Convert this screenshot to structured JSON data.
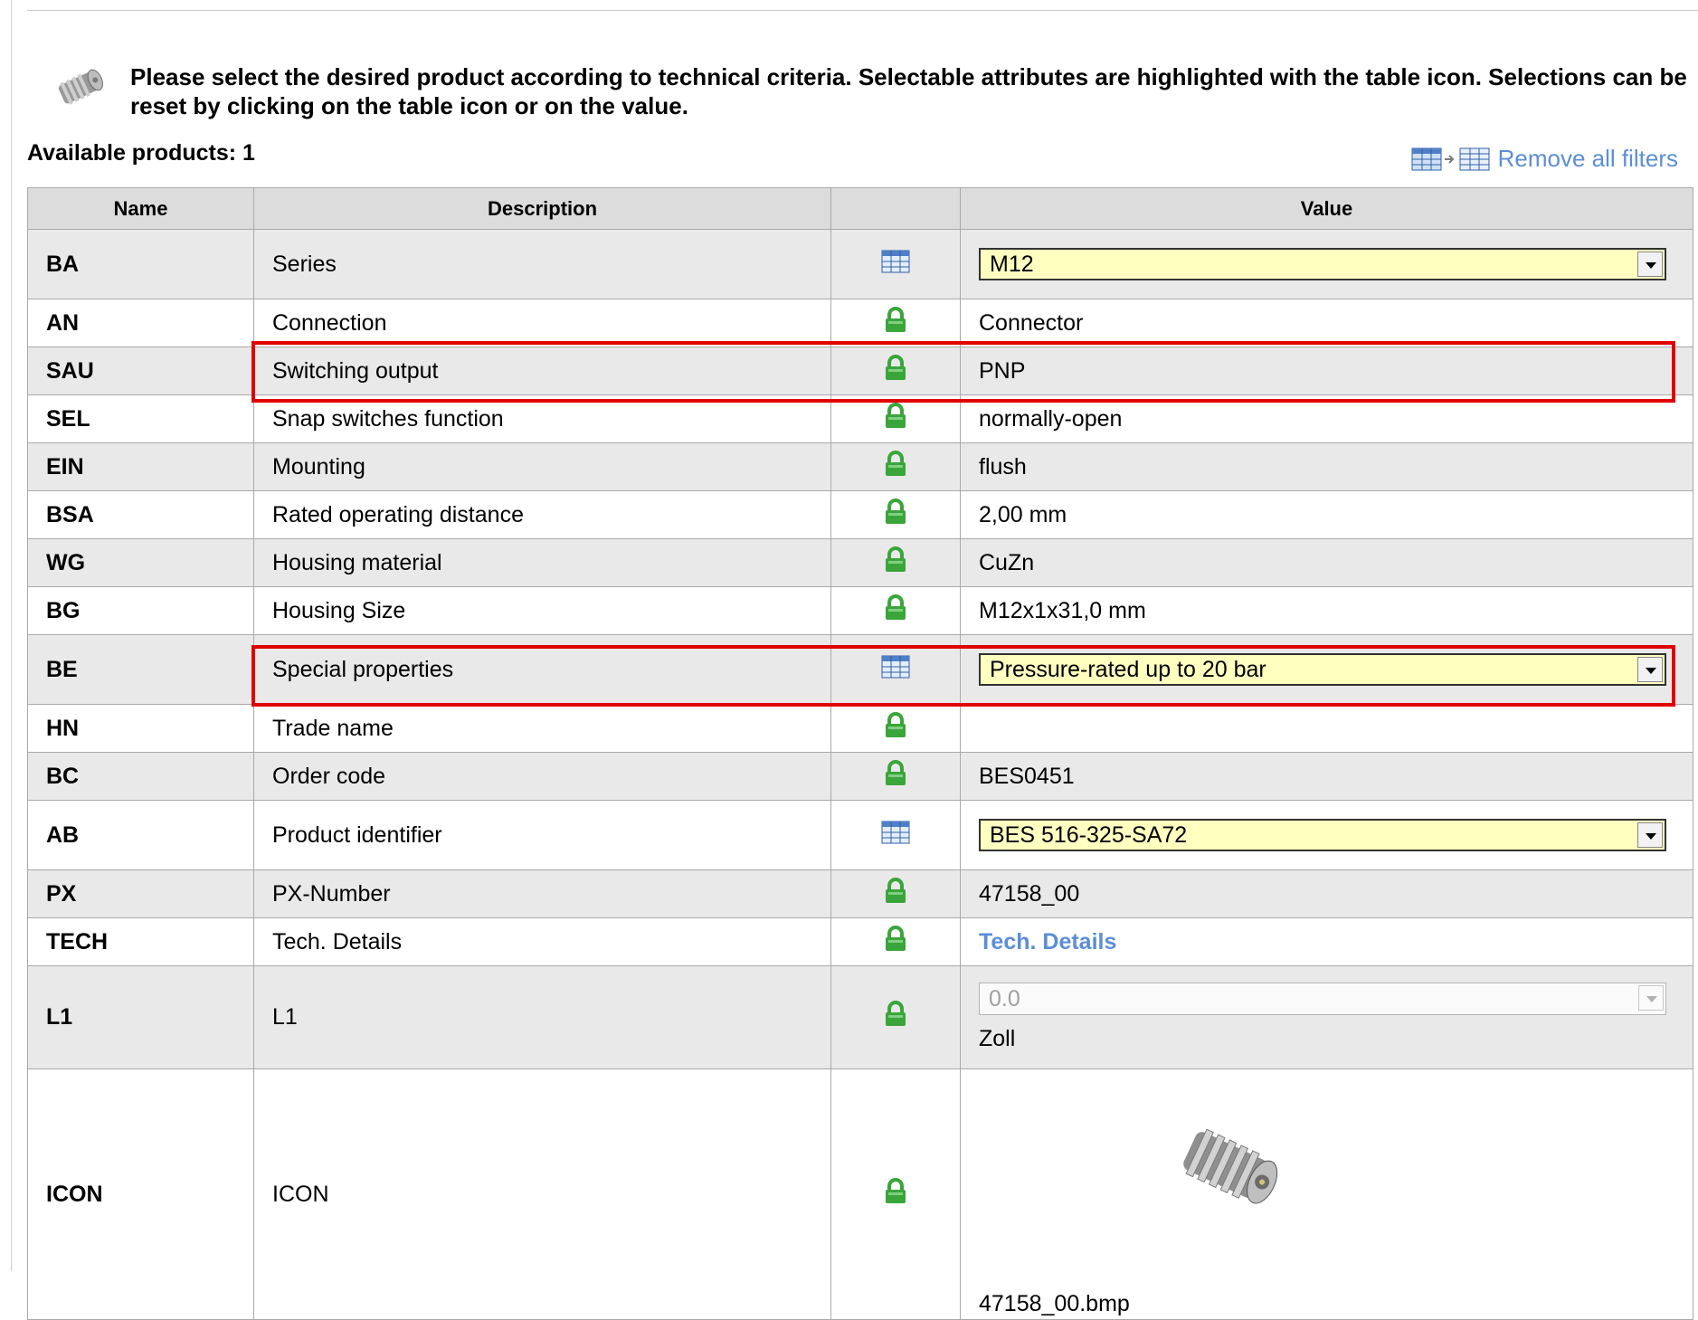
{
  "intro": {
    "text": "Please select the desired product according to technical criteria. Selectable attributes are highlighted with the table icon. Selections can be reset by clicking on the table icon or on the value."
  },
  "available_label": "Available products: 1",
  "remove_all_filters": "Remove all filters",
  "table": {
    "headers": {
      "name": "Name",
      "description": "Description",
      "icon": "",
      "value": "Value"
    },
    "rows": [
      {
        "name": "BA",
        "description": "Series",
        "icon": "table-icon",
        "value": "M12"
      },
      {
        "name": "AN",
        "description": "Connection",
        "icon": "lock-icon",
        "value": "Connector"
      },
      {
        "name": "SAU",
        "description": "Switching output",
        "icon": "lock-icon",
        "value": "PNP"
      },
      {
        "name": "SEL",
        "description": "Snap switches function",
        "icon": "lock-icon",
        "value": "normally-open"
      },
      {
        "name": "EIN",
        "description": "Mounting",
        "icon": "lock-icon",
        "value": "flush"
      },
      {
        "name": "BSA",
        "description": "Rated operating distance",
        "icon": "lock-icon",
        "value": "2,00 mm"
      },
      {
        "name": "WG",
        "description": "Housing material",
        "icon": "lock-icon",
        "value": "CuZn"
      },
      {
        "name": "BG",
        "description": "Housing Size",
        "icon": "lock-icon",
        "value": "M12x1x31,0 mm"
      },
      {
        "name": "BE",
        "description": "Special properties",
        "icon": "table-icon",
        "value": "Pressure-rated up to 20 bar"
      },
      {
        "name": "HN",
        "description": "Trade name",
        "icon": "lock-icon",
        "value": ""
      },
      {
        "name": "BC",
        "description": "Order code",
        "icon": "lock-icon",
        "value": "BES0451"
      },
      {
        "name": "AB",
        "description": "Product identifier",
        "icon": "table-icon",
        "value": "BES 516-325-SA72"
      },
      {
        "name": "PX",
        "description": "PX-Number",
        "icon": "lock-icon",
        "value": "47158_00"
      },
      {
        "name": "TECH",
        "description": "Tech. Details",
        "icon": "lock-icon",
        "value": "Tech. Details"
      },
      {
        "name": "L1",
        "description": "L1",
        "icon": "lock-icon",
        "value": "0.0",
        "unit": "Zoll"
      },
      {
        "name": "ICON",
        "description": "ICON",
        "icon": "lock-icon",
        "value": "47158_00.bmp"
      }
    ]
  },
  "colors": {
    "select_bg": "#ffffc0",
    "link": "#5b8ed6",
    "lock": "#3aa53a",
    "highlight": "#e00000",
    "row_alt": "#e9e9e9",
    "header_bg": "#dcdcdc"
  }
}
